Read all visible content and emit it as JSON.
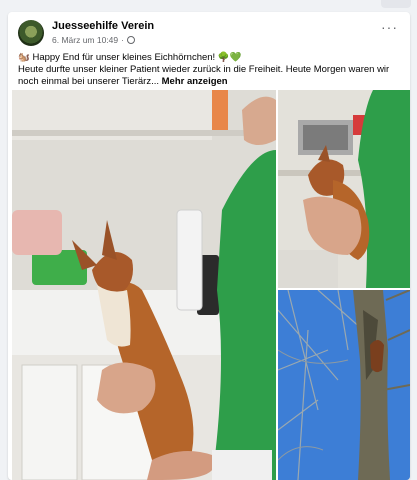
{
  "post": {
    "page_name": "Juesseehilfe Verein",
    "date": "6. März um 10:49",
    "separator": "·",
    "more_label": "···",
    "text_line1": "🐿️ Happy End für unser kleines Eichhörnchen! 🌳💚",
    "text_line2": "Heute durfte unser kleiner Patient wieder zurück in die Freiheit. Heute Morgen waren wir noch einmal bei unserer Tierärz...",
    "see_more": "Mehr anzeigen"
  },
  "photos": [
    {
      "subject": "squirrel-held-by-vet"
    },
    {
      "subject": "squirrel-in-hand"
    },
    {
      "subject": "squirrel-on-tree"
    }
  ],
  "colors": {
    "scrubs": "#2e9e4a",
    "squirrel": "#b5652a",
    "sky": "#3d7ed6"
  }
}
